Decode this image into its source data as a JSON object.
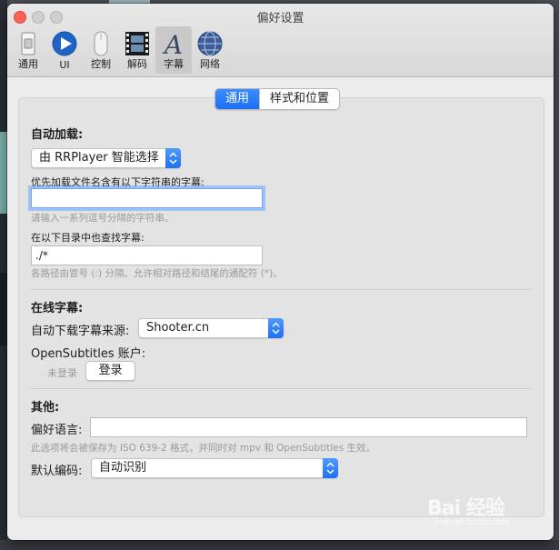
{
  "window": {
    "title": "偏好设置"
  },
  "toolbar": {
    "items": [
      {
        "label": "通用",
        "icon": "general-switch-icon"
      },
      {
        "label": "UI",
        "icon": "play-circle-icon"
      },
      {
        "label": "控制",
        "icon": "mouse-icon"
      },
      {
        "label": "解码",
        "icon": "film-strip-icon"
      },
      {
        "label": "字幕",
        "icon": "font-a-icon"
      },
      {
        "label": "网络",
        "icon": "globe-icon"
      }
    ],
    "selected": "字幕"
  },
  "tabs": {
    "items": [
      "通用",
      "样式和位置"
    ],
    "active": "通用"
  },
  "auto_load": {
    "heading": "自动加载:",
    "mode_value": "由 RRPlayer 智能选择",
    "prefer_label": "优先加载文件名含有以下字符串的字幕:",
    "prefer_value": "",
    "prefer_hint": "请输入一系列逗号分隔的字符串。",
    "search_label": "在以下目录中也查找字幕:",
    "search_value": "./*",
    "search_hint": "各路径由冒号 (:) 分隔。允许相对路径和结尾的通配符 (*)。"
  },
  "online": {
    "heading": "在线字幕:",
    "source_label": "自动下载字幕来源:",
    "source_value": "Shooter.cn",
    "account_label": "OpenSubtitles 账户:",
    "login_status": "未登录",
    "login_button": "登录"
  },
  "other": {
    "heading": "其他:",
    "lang_label": "偏好语言:",
    "lang_value": "",
    "lang_hint": "此选项将会被保存为 ISO 639-2 格式，并同时对 mpv 和 OpenSubtitles 生效。",
    "encoding_label": "默认编码:",
    "encoding_value": "自动识别"
  },
  "watermark": {
    "text": "Bai 经验",
    "sub": "jingyan.baidu.com"
  },
  "colors": {
    "accent": "#1b6ff5",
    "close": "#fe5f57"
  }
}
